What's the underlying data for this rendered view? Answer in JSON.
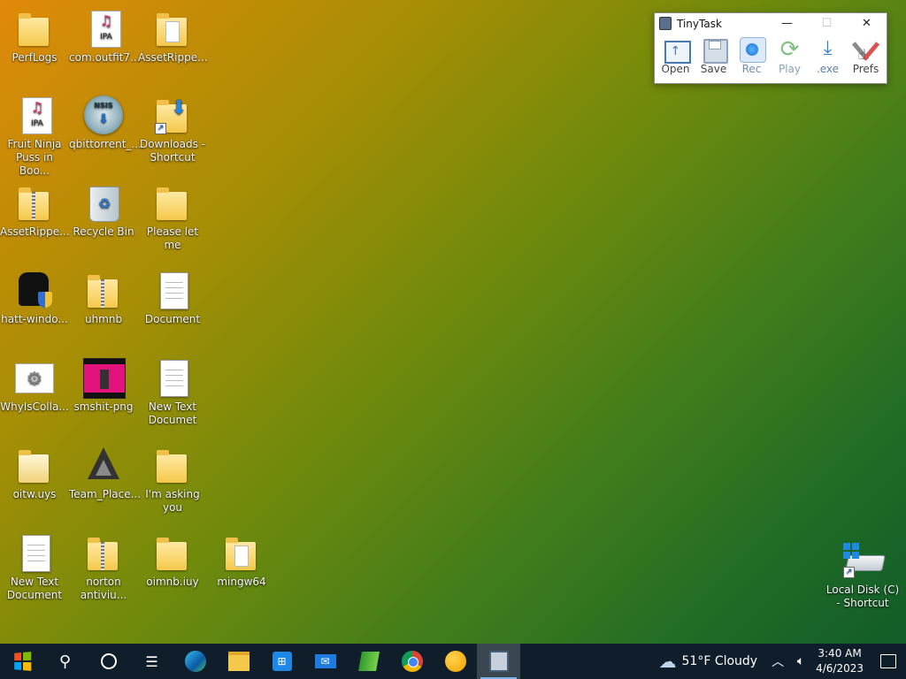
{
  "desktop": {
    "icons": [
      {
        "label": "PerfLogs"
      },
      {
        "label": "com.outfit7..."
      },
      {
        "label": "AssetRippe..."
      },
      {
        "label": "Fruit Ninja Puss in Boo..."
      },
      {
        "label": "qbittorrent_..."
      },
      {
        "label": "Downloads - Shortcut"
      },
      {
        "label": "AssetRippe..."
      },
      {
        "label": "Recycle Bin"
      },
      {
        "label": "‎Please let me"
      },
      {
        "label": "hatt-windo..."
      },
      {
        "label": "uhmnb"
      },
      {
        "label": "Document"
      },
      {
        "label": "WhyIsColla..."
      },
      {
        "label": "smshit-png"
      },
      {
        "label": "New Text Documet"
      },
      {
        "label": "oitw.uys"
      },
      {
        "label": "Team_Place..."
      },
      {
        "label": "I'm  asking you"
      },
      {
        "label": "New Text Document"
      },
      {
        "label": "norton antiviu..."
      },
      {
        "label": "oimnb.iuy"
      },
      {
        "label": "mingw64"
      },
      {
        "label": "Local Disk (C) - Shortcut"
      }
    ],
    "ipa_text": "IPA",
    "nsis_text": "NSIS"
  },
  "tinytask": {
    "title": "TinyTask",
    "buttons": {
      "open": "Open",
      "save": "Save",
      "rec": "Rec",
      "play": "Play",
      "exe": ".exe",
      "prefs": "Prefs"
    }
  },
  "taskbar": {
    "weather": "51°F  Cloudy",
    "time": "3:40 AM",
    "date": "4/6/2023"
  },
  "colors": {
    "taskbar_bg": "#0f1e2a",
    "accent": "#1a6fd0"
  }
}
